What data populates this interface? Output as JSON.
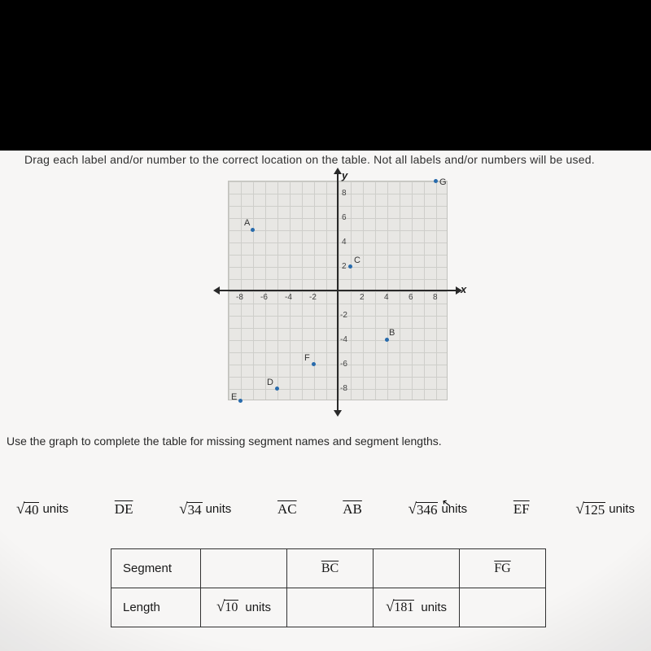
{
  "instruction": "Drag each label and/or number to the correct location on the table. Not all labels and/or numbers will be used.",
  "question2": "Use the graph to complete the table for missing segment names and segment lengths.",
  "axes": {
    "x_label": "x",
    "y_label": "y"
  },
  "ticks_x": [
    "-8",
    "-6",
    "-4",
    "-2",
    "2",
    "4",
    "6",
    "8"
  ],
  "ticks_y_pos": [
    "8",
    "6",
    "4",
    "2"
  ],
  "ticks_y_neg": [
    "-2",
    "-4",
    "-6",
    "-8"
  ],
  "points": {
    "A": {
      "x": -7,
      "y": 5
    },
    "B": {
      "x": 4,
      "y": -4
    },
    "C": {
      "x": 1,
      "y": 2
    },
    "D": {
      "x": -5,
      "y": -8
    },
    "E": {
      "x": -8,
      "y": -9
    },
    "F": {
      "x": -2,
      "y": -6
    },
    "G": {
      "x": 8,
      "y": 9
    }
  },
  "options": {
    "o1_val": "40",
    "o1_units": "units",
    "o2": "DE",
    "o3_val": "34",
    "o3_units": "units",
    "o4": "AC",
    "o5": "AB",
    "o6_val": "346",
    "o6_units": "units",
    "o7": "EF",
    "o8_val": "125",
    "o8_units": "units"
  },
  "table": {
    "row1_label": "Segment",
    "row2_label": "Length",
    "c_bc": "BC",
    "c_fg": "FG",
    "c_len1_val": "10",
    "c_len1_units": "units",
    "c_len2_val": "181",
    "c_len2_units": "units"
  },
  "chart_data": {
    "type": "scatter",
    "title": "",
    "xlabel": "x",
    "ylabel": "y",
    "xlim": [
      -9,
      9
    ],
    "ylim": [
      -9,
      9
    ],
    "grid": true,
    "series": [
      {
        "name": "points",
        "points": [
          {
            "label": "A",
            "x": -7,
            "y": 5
          },
          {
            "label": "B",
            "x": 4,
            "y": -4
          },
          {
            "label": "C",
            "x": 1,
            "y": 2
          },
          {
            "label": "D",
            "x": -5,
            "y": -8
          },
          {
            "label": "E",
            "x": -8,
            "y": -9
          },
          {
            "label": "F",
            "x": -2,
            "y": -6
          },
          {
            "label": "G",
            "x": 8,
            "y": 9
          }
        ]
      }
    ]
  }
}
